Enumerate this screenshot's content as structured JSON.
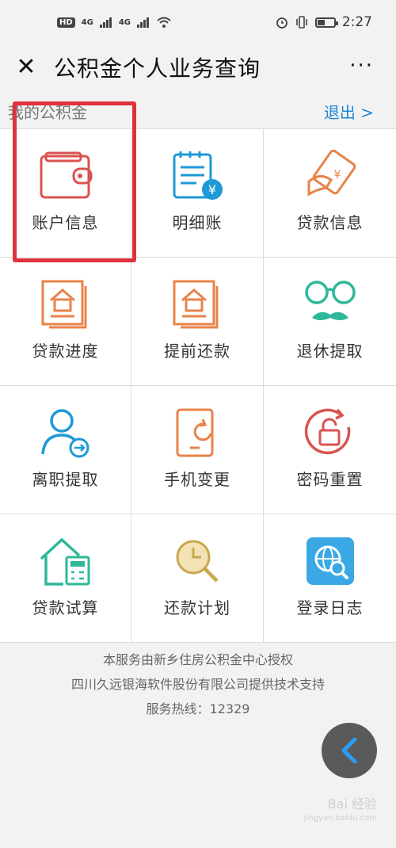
{
  "status_bar": {
    "hd_badge": "HD",
    "network_1": "4G",
    "network_2": "4G",
    "time": "2:27"
  },
  "header": {
    "title": "公积金个人业务查询",
    "close_glyph": "✕",
    "more_glyph": "···"
  },
  "section": {
    "label": "我的公积金",
    "logout": "退出 >"
  },
  "grid": [
    {
      "label": "账户信息",
      "icon": "wallet-icon"
    },
    {
      "label": "明细账",
      "icon": "ledger-icon"
    },
    {
      "label": "贷款信息",
      "icon": "loan-card-icon"
    },
    {
      "label": "贷款进度",
      "icon": "house-doc-icon"
    },
    {
      "label": "提前还款",
      "icon": "house-doc-icon"
    },
    {
      "label": "退休提取",
      "icon": "glasses-mustache-icon"
    },
    {
      "label": "离职提取",
      "icon": "user-exit-icon"
    },
    {
      "label": "手机变更",
      "icon": "phone-refresh-icon"
    },
    {
      "label": "密码重置",
      "icon": "lock-refresh-icon"
    },
    {
      "label": "贷款试算",
      "icon": "house-calculator-icon"
    },
    {
      "label": "还款计划",
      "icon": "clock-search-icon"
    },
    {
      "label": "登录日志",
      "icon": "globe-search-icon"
    }
  ],
  "footer": {
    "line1": "本服务由新乡住房公积金中心授权",
    "line2": "四川久远银海软件股份有限公司提供技术支持",
    "line3": "服务热线：12329"
  },
  "watermark": {
    "line1": "Bai 经验",
    "line2": "jingyan.baidu.com"
  },
  "colors": {
    "accent_link": "#1e88d6",
    "highlight": "#e0323c"
  }
}
